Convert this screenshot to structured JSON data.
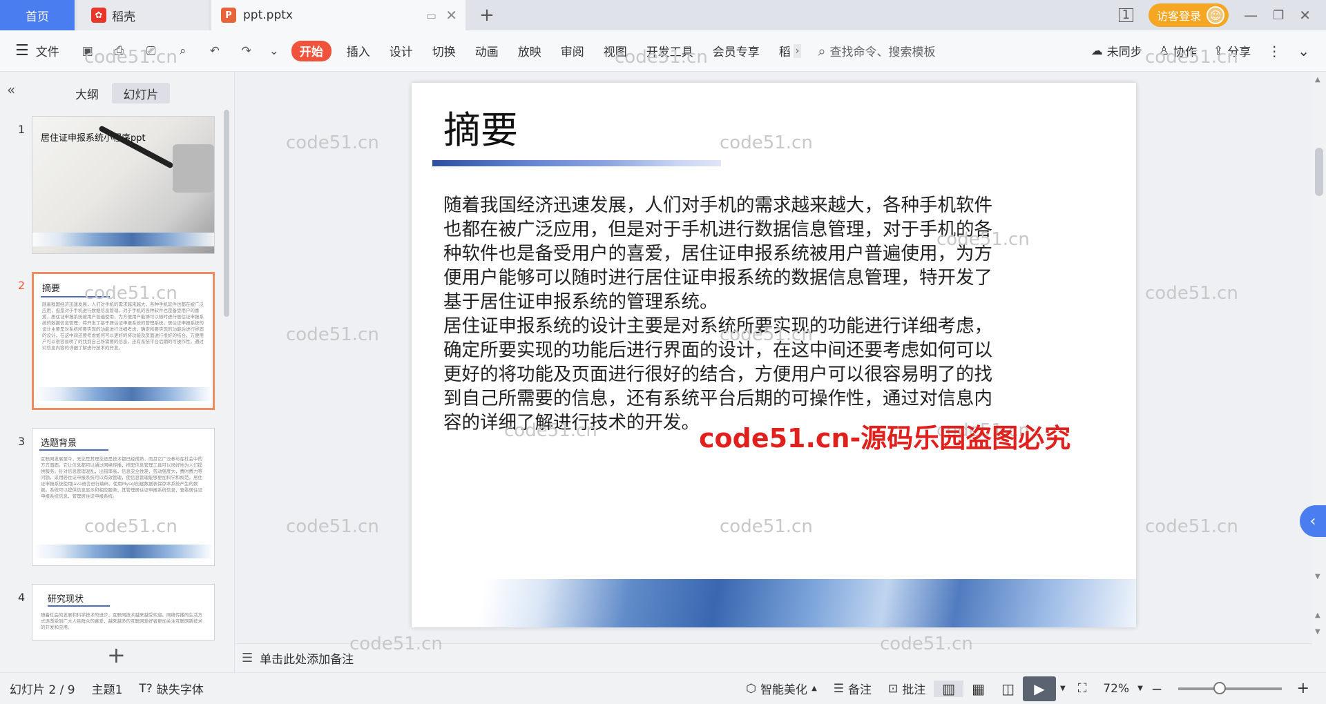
{
  "tabs": {
    "home": "首页",
    "daoke": "稻壳",
    "doc": "ppt.pptx"
  },
  "window": {
    "visitor_login": "访客登录"
  },
  "ribbon": {
    "file": "文件",
    "menus": [
      "开始",
      "插入",
      "设计",
      "切换",
      "动画",
      "放映",
      "审阅",
      "视图",
      "开发工具",
      "会员专享",
      "稻"
    ],
    "search_placeholder": "查找命令、搜索模板",
    "sync": "未同步",
    "collab": "协作",
    "share": "分享"
  },
  "panel": {
    "tab_outline": "大纲",
    "tab_slides": "幻灯片",
    "thumbs": [
      {
        "num": "1",
        "title": "居住证申报系统小程序ppt",
        "text": ""
      },
      {
        "num": "2",
        "title": "摘要",
        "text": "随着我国经济迅速发展，人们对手机的需求越来越大，各种手机软件也都在被广泛应用，但是对于手机进行数据信息管理，对于手机的各种软件也是备受用户的喜爱，居住证申报系统被用户普遍使用，为方便用户能够可以随时进行居住证申报系统的数据信息管理，特开发了基于居住证申报系统的管理系统。居住证申报系统的设计主要是对系统所要实现的功能进行详细考虑，确定所要实现的功能后进行界面的设计，在这中间还要考虑如何可以更好的将功能及页面进行很好的结合，方便用户可以很容易明了的找到自己所需要的信息，还有系统平台后期的可操作性，通过对信息内容的详细了解进行技术的开发。"
      },
      {
        "num": "3",
        "title": "选题背景",
        "text": "互联网发展至今，无论是其理论还是技术都已经成熟，而且它广泛参与在社会中的方方面面。它让信息都可以通过网络传播，搭配信息管理工具可以很好地为人们提供服务。针对信息管理混乱，出错率高，信息安全性差，劳动强度大，费时费力等问题，采用居住证申报系统可以有效管理，使信息管理能够更加科学和规范。居住证申报系统使用Java语言进行编码，使用Mysql创建数据表保存本系统产生的数据。系统可以提供信息显示和相应服务，其管理居住证申报系统信息，查看居住证申报系统信息，管理居住证申报系统。"
      },
      {
        "num": "4",
        "title": "研究现状",
        "text": "随着社会的发展和科学技术的进步，互联网技术越来越受欢迎。网络传播的生活方式逐渐受到广大人民群众的喜爱，越来越多的互联网爱好者更加关注互联网新技术的开发和应用。"
      }
    ],
    "add_slide": "+"
  },
  "slide": {
    "title": "摘要",
    "body": "随着我国经济迅速发展，人们对手机的需求越来越大，各种手机软件也都在被广泛应用，但是对于手机进行数据信息管理，对于手机的各种软件也是备受用户的喜爱，居住证申报系统被用户普遍使用，为方便用户能够可以随时进行居住证申报系统的数据信息管理，特开发了基于居住证申报系统的管理系统。\n居住证申报系统的设计主要是对系统所要实现的功能进行详细考虑，确定所要实现的功能后进行界面的设计，在这中间还要考虑如何可以更好的将功能及页面进行很好的结合，方便用户可以很容易明了的找到自己所需要的信息，还有系统平台后期的可操作性，通过对信息内容的详细了解进行技术的开发。",
    "watermark": "code51.cn",
    "watermark_red": "code51.cn-源码乐园盗图必究"
  },
  "notes": {
    "placeholder": "单击此处添加备注"
  },
  "status": {
    "slide_counter": "幻灯片 2 / 9",
    "theme": "主题1",
    "missing_font": "缺失字体",
    "beautify": "智能美化",
    "notes": "备注",
    "comment": "批注",
    "zoom": "72%",
    "zoom_level": 0.4
  },
  "colors": {
    "accent_blue": "#4a7df0",
    "start_red": "#f0533c",
    "visitor_orange": "#f5a623",
    "selected_thumb": "#f08a5f"
  }
}
